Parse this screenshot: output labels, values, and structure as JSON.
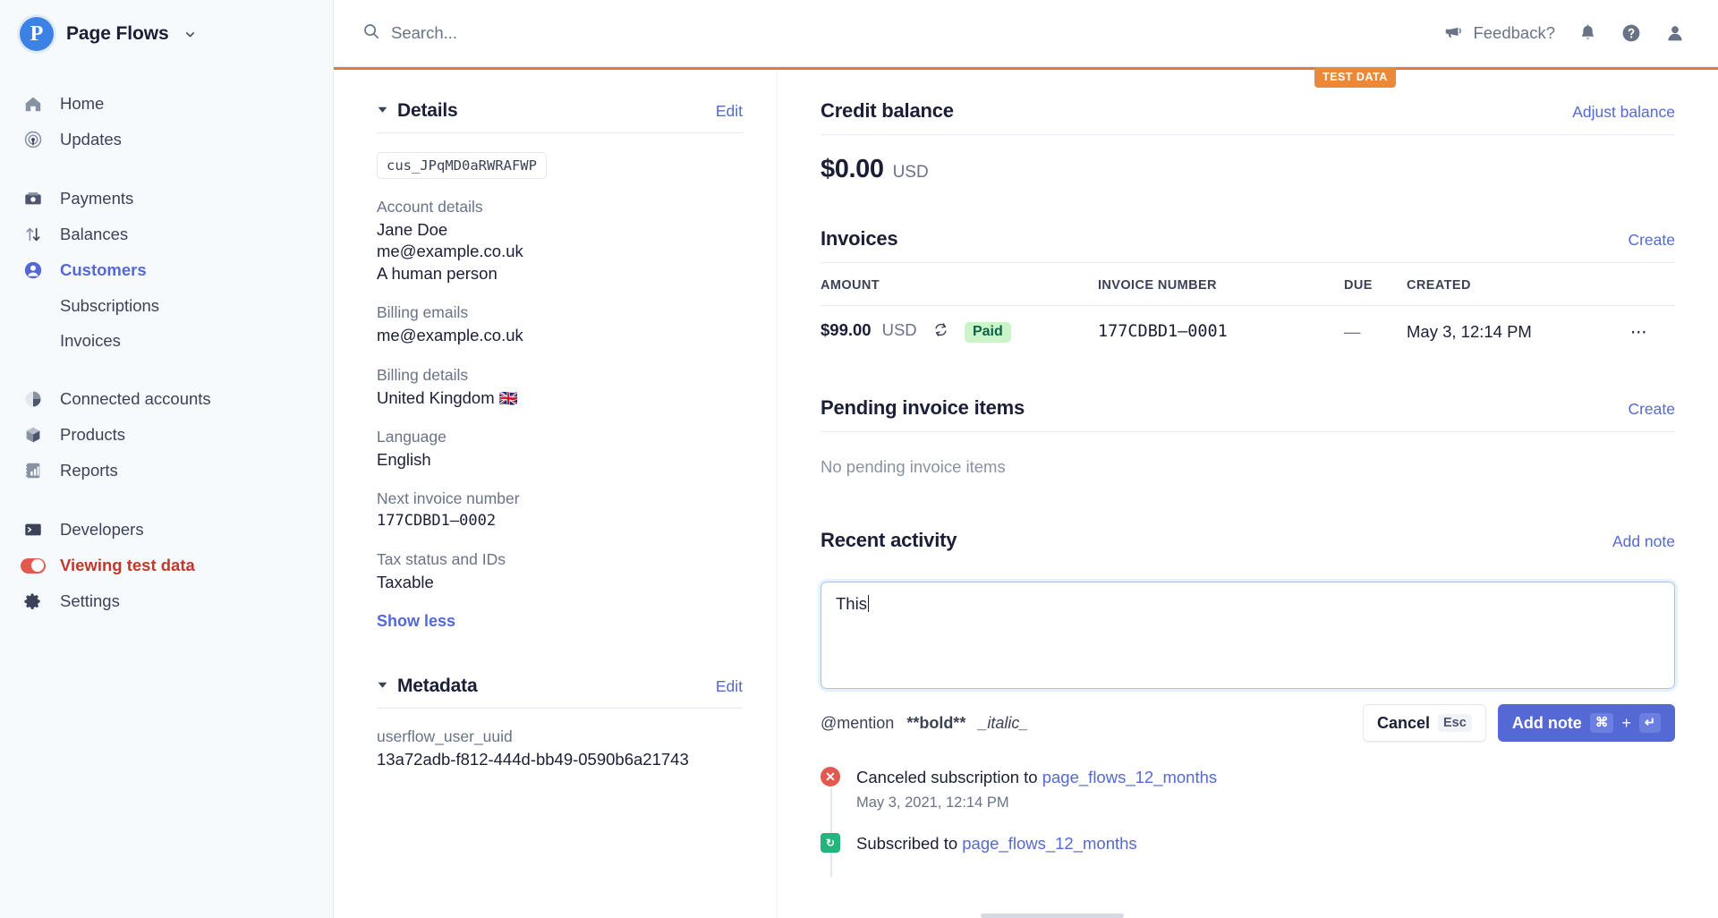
{
  "brand": {
    "name": "Page Flows",
    "logo_letter": "P",
    "caret_icon": "chevron-down-icon"
  },
  "sidebar": {
    "groups": [
      {
        "items": [
          {
            "label": "Home",
            "icon": "home-icon"
          },
          {
            "label": "Updates",
            "icon": "broadcast-icon"
          }
        ]
      },
      {
        "items": [
          {
            "label": "Payments",
            "icon": "payments-icon"
          },
          {
            "label": "Balances",
            "icon": "balances-icon"
          },
          {
            "label": "Customers",
            "icon": "customers-icon",
            "active": true
          }
        ],
        "subitems": [
          {
            "label": "Subscriptions"
          },
          {
            "label": "Invoices"
          }
        ]
      },
      {
        "items": [
          {
            "label": "Connected accounts",
            "icon": "connected-accounts-icon"
          },
          {
            "label": "Products",
            "icon": "products-icon"
          },
          {
            "label": "Reports",
            "icon": "reports-icon"
          }
        ]
      },
      {
        "items": [
          {
            "label": "Developers",
            "icon": "developers-icon"
          },
          {
            "label": "Viewing test data",
            "icon": "toggle-on-icon",
            "test": true
          },
          {
            "label": "Settings",
            "icon": "gear-icon"
          }
        ]
      }
    ]
  },
  "topbar": {
    "search_placeholder": "Search...",
    "feedback_label": "Feedback?",
    "icons": [
      "megaphone-icon",
      "bell-icon",
      "help-icon",
      "account-icon"
    ]
  },
  "test_banner": {
    "label": "TEST DATA",
    "color": "#ed8936"
  },
  "details": {
    "title": "Details",
    "edit_label": "Edit",
    "customer_id": "cus_JPqMD0aRWRAFWP",
    "fields": [
      {
        "label": "Account details",
        "values": [
          "Jane Doe",
          "me@example.co.uk",
          "A human person"
        ]
      },
      {
        "label": "Billing emails",
        "values": [
          "me@example.co.uk"
        ]
      },
      {
        "label": "Billing details",
        "values": [
          "United Kingdom"
        ],
        "flag": "🇬🇧"
      },
      {
        "label": "Language",
        "values": [
          "English"
        ]
      },
      {
        "label": "Next invoice number",
        "values": [
          "177CDBD1–0002"
        ],
        "mono": true
      },
      {
        "label": "Tax status and IDs",
        "values": [
          "Taxable"
        ]
      }
    ],
    "show_less_label": "Show less"
  },
  "metadata": {
    "title": "Metadata",
    "edit_label": "Edit",
    "key": "userflow_user_uuid",
    "value": "13a72adb-f812-444d-bb49-0590b6a21743"
  },
  "credit_balance": {
    "title": "Credit balance",
    "action_label": "Adjust balance",
    "amount": "$0.00",
    "currency": "USD"
  },
  "invoices": {
    "title": "Invoices",
    "action_label": "Create",
    "columns": [
      "AMOUNT",
      "INVOICE NUMBER",
      "DUE",
      "CREATED"
    ],
    "rows": [
      {
        "amount": "$99.00",
        "currency": "USD",
        "recurring_icon": "subscription-cycle-icon",
        "status": "Paid",
        "number": "177CDBD1–0001",
        "due": "—",
        "created": "May 3, 12:14 PM",
        "menu_icon": "overflow-menu-icon"
      }
    ]
  },
  "pending_invoice_items": {
    "title": "Pending invoice items",
    "action_label": "Create",
    "empty_text": "No pending invoice items"
  },
  "recent_activity": {
    "title": "Recent activity",
    "action_label": "Add note",
    "composer": {
      "value": "This",
      "hints": [
        "@mention",
        "**bold**",
        "_italic_"
      ],
      "cancel_label": "Cancel",
      "cancel_kbd": "Esc",
      "submit_label": "Add note",
      "submit_kbd_mod": "⌘",
      "submit_kbd_plus": "+",
      "submit_kbd_key": "↵"
    },
    "items": [
      {
        "icon": "canceled-icon",
        "text_before": "Canceled subscription to ",
        "link": "page_flows_12_months",
        "time": "May 3, 2021, 12:14 PM"
      },
      {
        "icon": "subscribed-icon",
        "text_before": "Subscribed to ",
        "link": "page_flows_12_months",
        "time": ""
      }
    ]
  }
}
